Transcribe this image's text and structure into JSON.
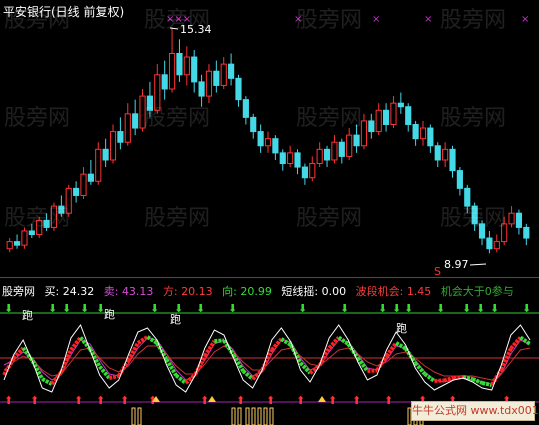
{
  "window": {
    "title": "平安银行(日线 前复权)"
  },
  "watermark_text": "股旁网",
  "price_chart": {
    "high_label": "15.34",
    "low_label": "8.97",
    "signal_marker": "S"
  },
  "indicator": {
    "name": "股旁网",
    "items": [
      {
        "label": "买:",
        "value": "24.32",
        "color": "#ffffff"
      },
      {
        "label": "卖:",
        "value": "43.13",
        "color": "#d94cd9"
      },
      {
        "label": "方:",
        "value": "20.13",
        "color": "#ff3a3a"
      },
      {
        "label": "向:",
        "value": "20.99",
        "color": "#33dd33"
      },
      {
        "label": "短线摇:",
        "value": "0.00",
        "color": "#ffffff"
      },
      {
        "label": "波段机会:",
        "value": "1.45",
        "color": "#ff3a3a"
      },
      {
        "label": "机会大于0参与",
        "value": "",
        "color": "#33aa33"
      }
    ],
    "run_label": "跑"
  },
  "stamp_text": "牛牛公式网 www.tdx001.com",
  "colors": {
    "up": "#ff3333",
    "down": "#44d9e6",
    "purple": "#cc33cc",
    "green": "#33dd33",
    "red": "#ff3a3a"
  },
  "candles": [
    {
      "o": 9.1,
      "c": 9.3,
      "h": 9.4,
      "l": 9.0
    },
    {
      "o": 9.3,
      "c": 9.2,
      "h": 9.5,
      "l": 9.1
    },
    {
      "o": 9.2,
      "c": 9.6,
      "h": 9.7,
      "l": 9.1
    },
    {
      "o": 9.6,
      "c": 9.5,
      "h": 9.8,
      "l": 9.4
    },
    {
      "o": 9.5,
      "c": 9.9,
      "h": 10.0,
      "l": 9.4
    },
    {
      "o": 9.9,
      "c": 9.7,
      "h": 10.1,
      "l": 9.6
    },
    {
      "o": 9.7,
      "c": 10.3,
      "h": 10.4,
      "l": 9.6
    },
    {
      "o": 10.3,
      "c": 10.1,
      "h": 10.6,
      "l": 10.0
    },
    {
      "o": 10.1,
      "c": 10.8,
      "h": 10.9,
      "l": 10.0
    },
    {
      "o": 10.8,
      "c": 10.6,
      "h": 11.0,
      "l": 10.4
    },
    {
      "o": 10.6,
      "c": 11.2,
      "h": 11.4,
      "l": 10.5
    },
    {
      "o": 11.2,
      "c": 11.0,
      "h": 11.6,
      "l": 10.9
    },
    {
      "o": 11.0,
      "c": 11.9,
      "h": 12.1,
      "l": 10.9
    },
    {
      "o": 11.9,
      "c": 11.6,
      "h": 12.2,
      "l": 11.4
    },
    {
      "o": 11.6,
      "c": 12.4,
      "h": 12.6,
      "l": 11.5
    },
    {
      "o": 12.4,
      "c": 12.1,
      "h": 12.8,
      "l": 11.9
    },
    {
      "o": 12.1,
      "c": 12.9,
      "h": 13.2,
      "l": 12.0
    },
    {
      "o": 12.9,
      "c": 12.5,
      "h": 13.3,
      "l": 12.3
    },
    {
      "o": 12.5,
      "c": 13.4,
      "h": 13.6,
      "l": 12.4
    },
    {
      "o": 13.4,
      "c": 13.0,
      "h": 13.8,
      "l": 12.8
    },
    {
      "o": 13.0,
      "c": 14.0,
      "h": 14.3,
      "l": 12.9
    },
    {
      "o": 14.0,
      "c": 13.6,
      "h": 14.4,
      "l": 13.3
    },
    {
      "o": 13.6,
      "c": 14.6,
      "h": 15.34,
      "l": 13.5
    },
    {
      "o": 14.6,
      "c": 14.0,
      "h": 15.0,
      "l": 13.8
    },
    {
      "o": 14.0,
      "c": 14.5,
      "h": 14.8,
      "l": 13.7
    },
    {
      "o": 14.5,
      "c": 13.8,
      "h": 14.7,
      "l": 13.5
    },
    {
      "o": 13.8,
      "c": 13.4,
      "h": 14.0,
      "l": 13.1
    },
    {
      "o": 13.4,
      "c": 14.1,
      "h": 14.3,
      "l": 13.2
    },
    {
      "o": 14.1,
      "c": 13.7,
      "h": 14.4,
      "l": 13.5
    },
    {
      "o": 13.7,
      "c": 14.3,
      "h": 14.5,
      "l": 13.6
    },
    {
      "o": 14.3,
      "c": 13.9,
      "h": 14.6,
      "l": 13.7
    },
    {
      "o": 13.9,
      "c": 13.3,
      "h": 14.0,
      "l": 13.1
    },
    {
      "o": 13.3,
      "c": 12.8,
      "h": 13.4,
      "l": 12.6
    },
    {
      "o": 12.8,
      "c": 12.4,
      "h": 12.9,
      "l": 12.2
    },
    {
      "o": 12.4,
      "c": 12.0,
      "h": 12.6,
      "l": 11.8
    },
    {
      "o": 12.0,
      "c": 12.2,
      "h": 12.4,
      "l": 11.8
    },
    {
      "o": 12.2,
      "c": 11.8,
      "h": 12.3,
      "l": 11.6
    },
    {
      "o": 11.8,
      "c": 11.5,
      "h": 11.9,
      "l": 11.3
    },
    {
      "o": 11.5,
      "c": 11.8,
      "h": 12.0,
      "l": 11.4
    },
    {
      "o": 11.8,
      "c": 11.4,
      "h": 11.9,
      "l": 11.2
    },
    {
      "o": 11.4,
      "c": 11.1,
      "h": 11.5,
      "l": 10.9
    },
    {
      "o": 11.1,
      "c": 11.5,
      "h": 11.7,
      "l": 11.0
    },
    {
      "o": 11.5,
      "c": 11.9,
      "h": 12.1,
      "l": 11.4
    },
    {
      "o": 11.9,
      "c": 11.6,
      "h": 12.0,
      "l": 11.4
    },
    {
      "o": 11.6,
      "c": 12.1,
      "h": 12.3,
      "l": 11.5
    },
    {
      "o": 12.1,
      "c": 11.7,
      "h": 12.2,
      "l": 11.5
    },
    {
      "o": 11.7,
      "c": 12.3,
      "h": 12.5,
      "l": 11.6
    },
    {
      "o": 12.3,
      "c": 12.0,
      "h": 12.6,
      "l": 11.8
    },
    {
      "o": 12.0,
      "c": 12.7,
      "h": 12.9,
      "l": 11.9
    },
    {
      "o": 12.7,
      "c": 12.4,
      "h": 12.9,
      "l": 12.2
    },
    {
      "o": 12.4,
      "c": 13.0,
      "h": 13.2,
      "l": 12.3
    },
    {
      "o": 13.0,
      "c": 12.6,
      "h": 13.2,
      "l": 12.4
    },
    {
      "o": 12.6,
      "c": 13.2,
      "h": 13.4,
      "l": 12.5
    },
    {
      "o": 13.2,
      "c": 13.1,
      "h": 13.5,
      "l": 12.9
    },
    {
      "o": 13.1,
      "c": 12.6,
      "h": 13.2,
      "l": 12.4
    },
    {
      "o": 12.6,
      "c": 12.2,
      "h": 12.7,
      "l": 12.0
    },
    {
      "o": 12.2,
      "c": 12.5,
      "h": 12.7,
      "l": 12.0
    },
    {
      "o": 12.5,
      "c": 12.0,
      "h": 12.6,
      "l": 11.8
    },
    {
      "o": 12.0,
      "c": 11.6,
      "h": 12.1,
      "l": 11.4
    },
    {
      "o": 11.6,
      "c": 11.9,
      "h": 12.1,
      "l": 11.4
    },
    {
      "o": 11.9,
      "c": 11.3,
      "h": 12.0,
      "l": 11.1
    },
    {
      "o": 11.3,
      "c": 10.8,
      "h": 11.4,
      "l": 10.6
    },
    {
      "o": 10.8,
      "c": 10.3,
      "h": 10.9,
      "l": 10.1
    },
    {
      "o": 10.3,
      "c": 9.8,
      "h": 10.4,
      "l": 9.6
    },
    {
      "o": 9.8,
      "c": 9.4,
      "h": 9.9,
      "l": 9.2
    },
    {
      "o": 9.4,
      "c": 9.1,
      "h": 9.6,
      "l": 8.97
    },
    {
      "o": 9.1,
      "c": 9.3,
      "h": 9.5,
      "l": 9.0
    },
    {
      "o": 9.3,
      "c": 9.8,
      "h": 10.0,
      "l": 9.2
    },
    {
      "o": 9.8,
      "c": 10.1,
      "h": 10.3,
      "l": 9.7
    },
    {
      "o": 10.1,
      "c": 9.7,
      "h": 10.2,
      "l": 9.5
    },
    {
      "o": 9.7,
      "c": 9.4,
      "h": 9.8,
      "l": 9.2
    }
  ],
  "ind_series": {
    "white": [
      30,
      55,
      70,
      48,
      22,
      18,
      40,
      72,
      85,
      60,
      35,
      22,
      30,
      55,
      78,
      82,
      70,
      45,
      25,
      18,
      35,
      62,
      80,
      75,
      52,
      30,
      22,
      40,
      70,
      82,
      68,
      40,
      28,
      45,
      72,
      85,
      70,
      48,
      30,
      35,
      60,
      78,
      65,
      42,
      28,
      20,
      25,
      30,
      32,
      28,
      22,
      20,
      45,
      75,
      85,
      70
    ],
    "purple": [
      45,
      50,
      58,
      52,
      38,
      30,
      36,
      55,
      70,
      66,
      50,
      36,
      34,
      46,
      62,
      72,
      70,
      56,
      40,
      30,
      34,
      50,
      66,
      70,
      60,
      44,
      34,
      38,
      56,
      70,
      68,
      52,
      40,
      44,
      58,
      70,
      68,
      56,
      42,
      40,
      50,
      64,
      62,
      50,
      38,
      30,
      28,
      30,
      32,
      30,
      28,
      26,
      36,
      56,
      70,
      66
    ],
    "red": [
      40,
      48,
      54,
      50,
      40,
      34,
      36,
      48,
      60,
      62,
      52,
      42,
      38,
      44,
      56,
      64,
      64,
      56,
      44,
      36,
      36,
      46,
      58,
      64,
      58,
      48,
      40,
      40,
      50,
      60,
      62,
      54,
      46,
      44,
      52,
      60,
      62,
      56,
      48,
      44,
      48,
      56,
      58,
      52,
      44,
      38,
      34,
      34,
      34,
      34,
      32,
      30,
      36,
      48,
      60,
      62
    ]
  }
}
